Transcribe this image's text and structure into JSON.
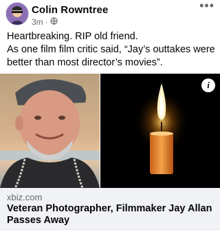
{
  "post": {
    "author": "Colin Rowntree",
    "time": "3m",
    "audience_icon": "globe-icon",
    "more_icon": "more-options-icon",
    "text_lines": [
      "Heartbreaking. RIP old friend.",
      "As one film film critic said, “Jay’s outtakes were",
      "better than most director’s movies”."
    ]
  },
  "media": {
    "info_glyph": "i"
  },
  "link": {
    "domain": "xbiz.com",
    "title": "Veteran Photographer, Filmmaker Jay Allan Passes Away"
  },
  "colors": {
    "secondary_text": "#65676b",
    "link_card_bg": "#f0f2f5"
  }
}
